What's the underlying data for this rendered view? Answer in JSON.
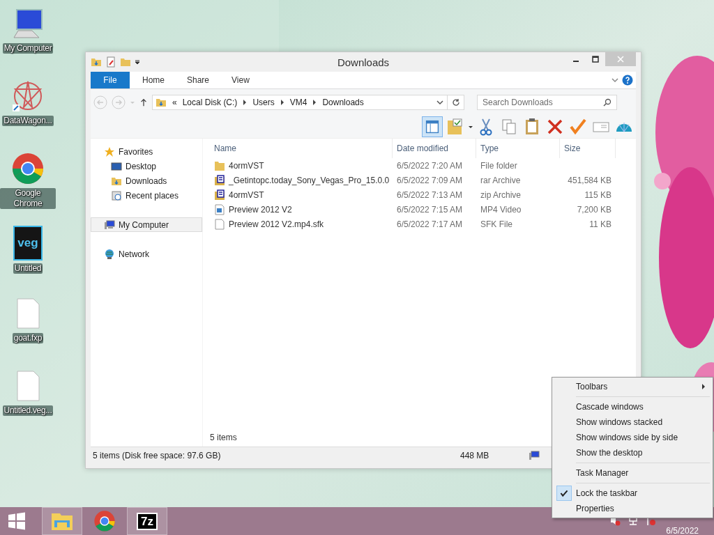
{
  "desktop_icons": [
    {
      "label": "My Computer",
      "kind": "computer"
    },
    {
      "label": "DataWagon...",
      "kind": "star"
    },
    {
      "label": "Google Chrome",
      "kind": "chrome"
    },
    {
      "label": "Untitled",
      "kind": "veg",
      "badge": "veg"
    },
    {
      "label": "goat.fxp",
      "kind": "file"
    },
    {
      "label": "Untitled.veg...",
      "kind": "file"
    }
  ],
  "window": {
    "title": "Downloads"
  },
  "ribbon_tabs": [
    {
      "label": "File",
      "kind": "file",
      "selected": false
    },
    {
      "label": "Home",
      "kind": "tab",
      "selected": false
    },
    {
      "label": "Share",
      "kind": "tab",
      "selected": false
    },
    {
      "label": "View",
      "kind": "tab",
      "selected": false
    }
  ],
  "address": {
    "overflow": "«",
    "breadcrumb": [
      "Local Disk (C:)",
      "Users",
      "VM4",
      "Downloads"
    ]
  },
  "search": {
    "placeholder": "Search Downloads"
  },
  "navigation": [
    {
      "label": "Favorites",
      "kind": "star",
      "selected": false,
      "children": [
        {
          "label": "Desktop",
          "kind": "desktop",
          "selected": false
        },
        {
          "label": "Downloads",
          "kind": "folder",
          "selected": false
        },
        {
          "label": "Recent places",
          "kind": "recent",
          "selected": false
        }
      ]
    },
    {
      "label": "My Computer",
      "kind": "computer",
      "selected": true
    },
    {
      "label": "Network",
      "kind": "network",
      "selected": false
    }
  ],
  "table": {
    "columns": [
      "Name",
      "Date modified",
      "Type",
      "Size"
    ],
    "rows": [
      {
        "kind": "folder",
        "name": "4ormVST",
        "date": "6/5/2022 7:20 AM",
        "type": "File folder",
        "size": ""
      },
      {
        "kind": "rar",
        "name": "_Getintopc.today_Sony_Vegas_Pro_15.0.0",
        "date": "6/5/2022 7:09 AM",
        "type": "rar Archive",
        "size": "451,584 KB"
      },
      {
        "kind": "zip",
        "name": "4ormVST",
        "date": "6/5/2022 7:13 AM",
        "type": "zip Archive",
        "size": "115 KB"
      },
      {
        "kind": "video",
        "name": "Preview 2012 V2",
        "date": "6/5/2022 7:15 AM",
        "type": "MP4 Video",
        "size": "7,200 KB"
      },
      {
        "kind": "file",
        "name": "Preview 2012 V2.mp4.sfk",
        "date": "6/5/2022 7:17 AM",
        "type": "SFK File",
        "size": "11 KB"
      }
    ]
  },
  "item_count": "5 items",
  "status_bar": {
    "summary": "5 items (Disk free space: 97.6 GB)",
    "size": "448 MB"
  },
  "context_menu": [
    {
      "kind": "submenu",
      "label": "Toolbars",
      "checked": false
    },
    {
      "kind": "separator"
    },
    {
      "kind": "item",
      "label": "Cascade windows",
      "checked": false
    },
    {
      "kind": "item",
      "label": "Show windows stacked",
      "checked": false
    },
    {
      "kind": "item",
      "label": "Show windows side by side",
      "checked": false
    },
    {
      "kind": "item",
      "label": "Show the desktop",
      "checked": false
    },
    {
      "kind": "separator"
    },
    {
      "kind": "item",
      "label": "Task Manager",
      "checked": false
    },
    {
      "kind": "separator"
    },
    {
      "kind": "item",
      "label": "Lock the taskbar",
      "checked": true
    },
    {
      "kind": "item",
      "label": "Properties",
      "checked": false
    }
  ],
  "taskbar": {
    "apps": [
      {
        "kind": "explorer",
        "open": true
      },
      {
        "kind": "chrome",
        "open": false
      },
      {
        "kind": "sevenzip",
        "open": true,
        "label": "7z"
      }
    ],
    "date": "6/5/2022"
  }
}
